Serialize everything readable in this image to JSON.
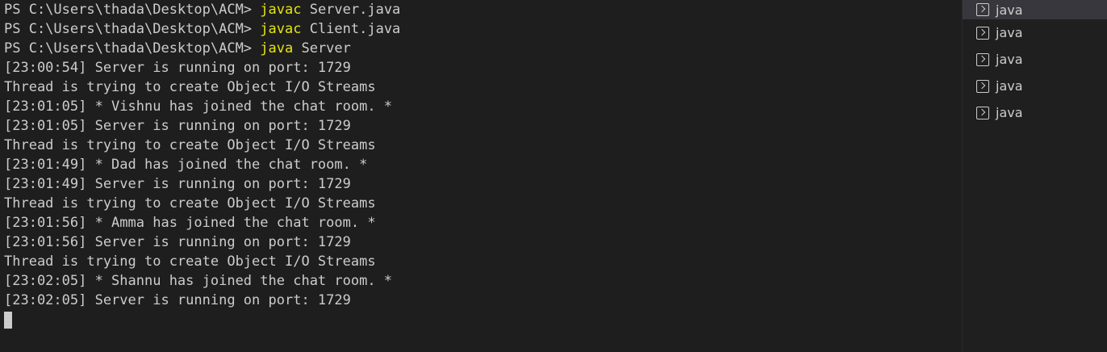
{
  "terminal": {
    "lines": [
      {
        "prompt": "PS C:\\Users\\thada\\Desktop\\ACM> ",
        "command": "javac",
        "args": " Server.java"
      },
      {
        "prompt": "PS C:\\Users\\thada\\Desktop\\ACM> ",
        "command": "javac",
        "args": " Client.java"
      },
      {
        "prompt": "PS C:\\Users\\thada\\Desktop\\ACM> ",
        "command": "java",
        "args": " Server"
      },
      {
        "text": "[23:00:54] Server is running on port: 1729"
      },
      {
        "text": "Thread is trying to create Object I/O Streams"
      },
      {
        "text": "[23:01:05] * Vishnu has joined the chat room. *"
      },
      {
        "text": "[23:01:05] Server is running on port: 1729"
      },
      {
        "text": "Thread is trying to create Object I/O Streams"
      },
      {
        "text": "[23:01:49] * Dad has joined the chat room. *"
      },
      {
        "text": "[23:01:49] Server is running on port: 1729"
      },
      {
        "text": "Thread is trying to create Object I/O Streams"
      },
      {
        "text": "[23:01:56] * Amma has joined the chat room. *"
      },
      {
        "text": "[23:01:56] Server is running on port: 1729"
      },
      {
        "text": "Thread is trying to create Object I/O Streams"
      },
      {
        "text": "[23:02:05] * Shannu has joined the chat room. *"
      },
      {
        "text": "[23:02:05] Server is running on port: 1729"
      }
    ]
  },
  "terminal_tabs": [
    {
      "label": "java",
      "icon": "terminal-icon",
      "active": true
    },
    {
      "label": "java",
      "icon": "terminal-icon",
      "active": false
    },
    {
      "label": "java",
      "icon": "terminal-icon",
      "active": false
    },
    {
      "label": "java",
      "icon": "terminal-icon",
      "active": false
    },
    {
      "label": "java",
      "icon": "terminal-icon",
      "active": false
    }
  ],
  "colors": {
    "background": "#1e1e1e",
    "text": "#cccccc",
    "command": "#e5e510",
    "active_tab": "#37373d"
  }
}
